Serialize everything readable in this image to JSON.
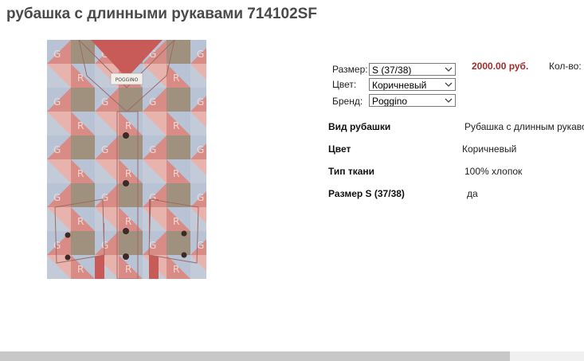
{
  "page": {
    "title": "рубашка с длинными рукавами 714102SF"
  },
  "product_image": {
    "brand_tag": "POGGINO"
  },
  "options": {
    "size": {
      "label": "Размер:",
      "value": "S (37/38)"
    },
    "color": {
      "label": "Цвет:",
      "value": "Коричневый"
    },
    "brand": {
      "label": "Бренд:",
      "value": "Poggino"
    }
  },
  "price": "2000.00 руб.",
  "quantity_label": "Кол-во:",
  "attributes": [
    {
      "name": "Вид рубашки",
      "value": "Рубашка с длинным рукавом"
    },
    {
      "name": "Цвет",
      "value": "Коричневый"
    },
    {
      "name": "Тип ткани",
      "value": "100% хлопок"
    },
    {
      "name": "Размер S (37/38)",
      "value": "да"
    }
  ],
  "colors": {
    "price": "#a52a2a",
    "title": "#4a4a4a"
  }
}
